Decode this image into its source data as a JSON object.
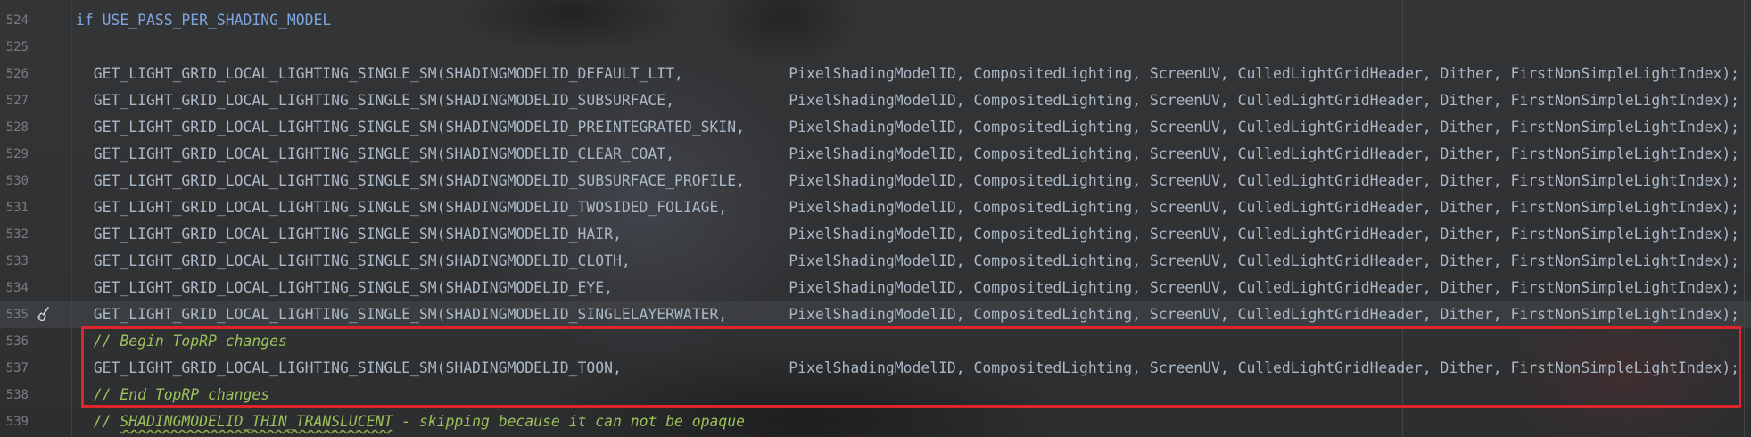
{
  "editor": {
    "lines": [
      {
        "number": "524",
        "parts": [
          {
            "text": "if",
            "kind": "keyword"
          },
          {
            "text": " USE_PASS_PER_SHADING_MODEL",
            "kind": "macro"
          }
        ]
      },
      {
        "number": "525",
        "parts": []
      },
      {
        "number": "526",
        "parts": [
          {
            "text": "  GET_LIGHT_GRID_LOCAL_LIGHTING_SINGLE_SM(SHADINGMODELID_DEFAULT_LIT,            PixelShadingModelID, CompositedLighting, ScreenUV, CulledLightGridHeader, Dither, FirstNonSimpleLightIndex);",
            "kind": "code"
          }
        ]
      },
      {
        "number": "527",
        "parts": [
          {
            "text": "  GET_LIGHT_GRID_LOCAL_LIGHTING_SINGLE_SM(SHADINGMODELID_SUBSURFACE,             PixelShadingModelID, CompositedLighting, ScreenUV, CulledLightGridHeader, Dither, FirstNonSimpleLightIndex);",
            "kind": "code"
          }
        ]
      },
      {
        "number": "528",
        "parts": [
          {
            "text": "  GET_LIGHT_GRID_LOCAL_LIGHTING_SINGLE_SM(SHADINGMODELID_PREINTEGRATED_SKIN,     PixelShadingModelID, CompositedLighting, ScreenUV, CulledLightGridHeader, Dither, FirstNonSimpleLightIndex);",
            "kind": "code"
          }
        ]
      },
      {
        "number": "529",
        "parts": [
          {
            "text": "  GET_LIGHT_GRID_LOCAL_LIGHTING_SINGLE_SM(SHADINGMODELID_CLEAR_COAT,             PixelShadingModelID, CompositedLighting, ScreenUV, CulledLightGridHeader, Dither, FirstNonSimpleLightIndex);",
            "kind": "code"
          }
        ]
      },
      {
        "number": "530",
        "parts": [
          {
            "text": "  GET_LIGHT_GRID_LOCAL_LIGHTING_SINGLE_SM(SHADINGMODELID_SUBSURFACE_PROFILE,     PixelShadingModelID, CompositedLighting, ScreenUV, CulledLightGridHeader, Dither, FirstNonSimpleLightIndex);",
            "kind": "code"
          }
        ]
      },
      {
        "number": "531",
        "parts": [
          {
            "text": "  GET_LIGHT_GRID_LOCAL_LIGHTING_SINGLE_SM(SHADINGMODELID_TWOSIDED_FOLIAGE,       PixelShadingModelID, CompositedLighting, ScreenUV, CulledLightGridHeader, Dither, FirstNonSimpleLightIndex);",
            "kind": "code"
          }
        ]
      },
      {
        "number": "532",
        "parts": [
          {
            "text": "  GET_LIGHT_GRID_LOCAL_LIGHTING_SINGLE_SM(SHADINGMODELID_HAIR,                   PixelShadingModelID, CompositedLighting, ScreenUV, CulledLightGridHeader, Dither, FirstNonSimpleLightIndex);",
            "kind": "code"
          }
        ]
      },
      {
        "number": "533",
        "parts": [
          {
            "text": "  GET_LIGHT_GRID_LOCAL_LIGHTING_SINGLE_SM(SHADINGMODELID_CLOTH,                  PixelShadingModelID, CompositedLighting, ScreenUV, CulledLightGridHeader, Dither, FirstNonSimpleLightIndex);",
            "kind": "code"
          }
        ]
      },
      {
        "number": "534",
        "parts": [
          {
            "text": "  GET_LIGHT_GRID_LOCAL_LIGHTING_SINGLE_SM(SHADINGMODELID_EYE,                    PixelShadingModelID, CompositedLighting, ScreenUV, CulledLightGridHeader, Dither, FirstNonSimpleLightIndex);",
            "kind": "code"
          }
        ]
      },
      {
        "number": "535",
        "current": true,
        "parts": [
          {
            "text": "  GET_LIGHT_GRID_LOCAL_LIGHTING_SINGLE_SM(SHADINGMODELID_SINGLELAYERWATER,       PixelShadingModelID, CompositedLighting, ScreenUV, CulledLightGridHeader, Dither, FirstNonSimpleLightIndex);",
            "kind": "code"
          }
        ]
      },
      {
        "number": "536",
        "parts": [
          {
            "text": "  ",
            "kind": "code"
          },
          {
            "text": "// Begin TopRP changes",
            "kind": "comment"
          }
        ]
      },
      {
        "number": "537",
        "parts": [
          {
            "text": "  GET_LIGHT_GRID_LOCAL_LIGHTING_SINGLE_SM(SHADINGMODELID_TOON,                   PixelShadingModelID, CompositedLighting, ScreenUV, CulledLightGridHeader, Dither, FirstNonSimpleLightIndex);",
            "kind": "code"
          }
        ]
      },
      {
        "number": "538",
        "parts": [
          {
            "text": "  ",
            "kind": "code"
          },
          {
            "text": "// End TopRP changes",
            "kind": "comment"
          }
        ]
      },
      {
        "number": "539",
        "parts": [
          {
            "text": "  ",
            "kind": "code"
          },
          {
            "text": "// ",
            "kind": "comment"
          },
          {
            "text": "SHADINGMODELID_THIN_TRANSLUCENT",
            "kind": "comment-underlined"
          },
          {
            "text": " - skipping because it can not be opaque",
            "kind": "comment"
          }
        ]
      }
    ]
  },
  "colors": {
    "keyword": "#7fa5e0",
    "macro": "#7fa5e0",
    "code": "#a9b7c6",
    "comment": "#9bc25a",
    "line_number": "#7a7c80",
    "highlight_border": "#e0242a"
  },
  "gutter_icon": "broom-icon"
}
